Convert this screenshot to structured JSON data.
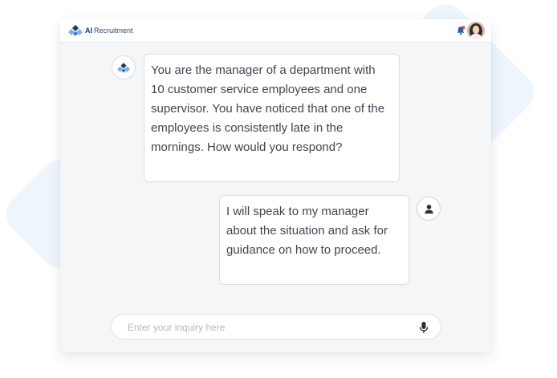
{
  "header": {
    "brand_prefix": "AI",
    "brand_name": "Recruitment",
    "logo_icon": "diamond-logo-icon",
    "notification_icon": "bell-icon",
    "avatar_icon": "user-photo"
  },
  "chat": {
    "messages": [
      {
        "sender": "bot",
        "text": "You are the manager of a department with 10 customer service employees and one supervisor. You have noticed that one of the employees is consistently late in the mornings. How would you respond?"
      },
      {
        "sender": "user",
        "text": "I will speak to my manager about the situation and ask for guidance on how to proceed."
      }
    ]
  },
  "input": {
    "placeholder": "Enter your inquiry here",
    "value": "",
    "mic_icon": "microphone-icon"
  },
  "colors": {
    "brand_dark": "#1f3a63",
    "brand_blue": "#2f7fd1",
    "bell_red": "#e04444",
    "bell_blue": "#2b5ea8",
    "window_bg": "#f5f6f7",
    "bubble_border": "#d9dde2",
    "text": "#3f4650"
  }
}
